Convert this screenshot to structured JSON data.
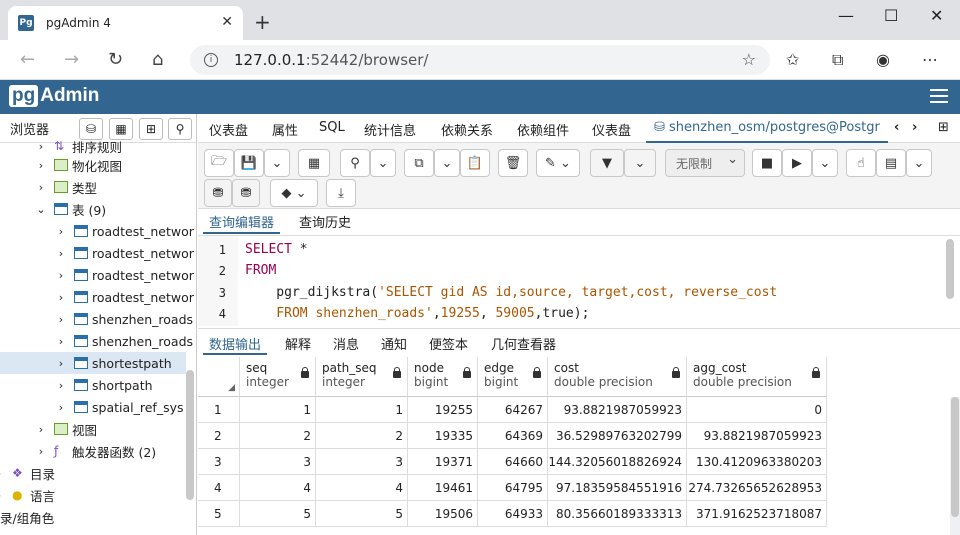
{
  "browser": {
    "tab_title": "pgAdmin 4",
    "favicon": "Pg",
    "url_host": "127.0.0.1",
    "url_rest": ":52442/browser/"
  },
  "app": {
    "logo_pg": "pg",
    "logo_rest": "Admin"
  },
  "sidebar": {
    "header": "浏览器",
    "items": [
      {
        "label": "排序规则",
        "icon": "collation-icon"
      },
      {
        "label": "物化视图",
        "icon": "materialized-view-icon"
      },
      {
        "label": "类型",
        "icon": "type-icon"
      },
      {
        "label": "表 (9)",
        "icon": "tables-icon"
      },
      {
        "label": "roadtest_networ",
        "icon": "table-icon"
      },
      {
        "label": "roadtest_networ",
        "icon": "table-icon"
      },
      {
        "label": "roadtest_networ",
        "icon": "table-icon"
      },
      {
        "label": "roadtest_networ",
        "icon": "table-icon"
      },
      {
        "label": "shenzhen_roads",
        "icon": "table-icon"
      },
      {
        "label": "shenzhen_roads",
        "icon": "table-icon"
      },
      {
        "label": "shortestpath",
        "icon": "table-icon"
      },
      {
        "label": "shortpath",
        "icon": "table-icon"
      },
      {
        "label": "spatial_ref_sys",
        "icon": "table-icon"
      },
      {
        "label": "视图",
        "icon": "view-icon"
      },
      {
        "label": "触发器函数 (2)",
        "icon": "trigger-function-icon"
      },
      {
        "label": "目录",
        "icon": "catalog-icon"
      },
      {
        "label": "语言",
        "icon": "language-icon"
      },
      {
        "label": "录/组角色",
        "icon": "role-icon"
      }
    ]
  },
  "main_tabs": [
    "仪表盘",
    "属性",
    "SQL",
    "统计信息",
    "依赖关系",
    "依赖组件",
    "仪表盘",
    "shenzhen_osm/postgres@Postgr"
  ],
  "toolbar": {
    "limit": "无限制"
  },
  "query_tabs": [
    "查询编辑器",
    "查询历史"
  ],
  "editor": {
    "line_numbers": [
      "1",
      "2",
      "3",
      "4"
    ],
    "line1_kw": "SELECT",
    "line1_rest": " *",
    "line2_kw": "FROM",
    "line3_fn": "    pgr_dijkstra(",
    "line3_str": "'SELECT gid AS id,source, target,cost, reverse_cost",
    "line4_str": "    FROM shenzhen_roads'",
    "line4_sep1": ",",
    "line4_n1": "19255",
    "line4_sep2": ", ",
    "line4_n2": "59005",
    "line4_end": ",true);"
  },
  "output_tabs": [
    "数据输出",
    "解释",
    "消息",
    "通知",
    "便签本",
    "几何查看器"
  ],
  "grid": {
    "columns": [
      {
        "name": "seq",
        "type": "integer"
      },
      {
        "name": "path_seq",
        "type": "integer"
      },
      {
        "name": "node",
        "type": "bigint"
      },
      {
        "name": "edge",
        "type": "bigint"
      },
      {
        "name": "cost",
        "type": "double precision"
      },
      {
        "name": "agg_cost",
        "type": "double precision"
      }
    ],
    "rows": [
      [
        "1",
        "1",
        "1",
        "19255",
        "64267",
        "93.8821987059923",
        "0"
      ],
      [
        "2",
        "2",
        "2",
        "19335",
        "64369",
        "36.52989763202799",
        "93.8821987059923"
      ],
      [
        "3",
        "3",
        "3",
        "19371",
        "64660",
        "144.32056018826924",
        "130.4120963380203"
      ],
      [
        "4",
        "4",
        "4",
        "19461",
        "64795",
        "97.18359584551916",
        "274.73265652628953"
      ],
      [
        "5",
        "5",
        "5",
        "19506",
        "64933",
        "80.35660189333313",
        "371.9162523718087"
      ]
    ]
  }
}
